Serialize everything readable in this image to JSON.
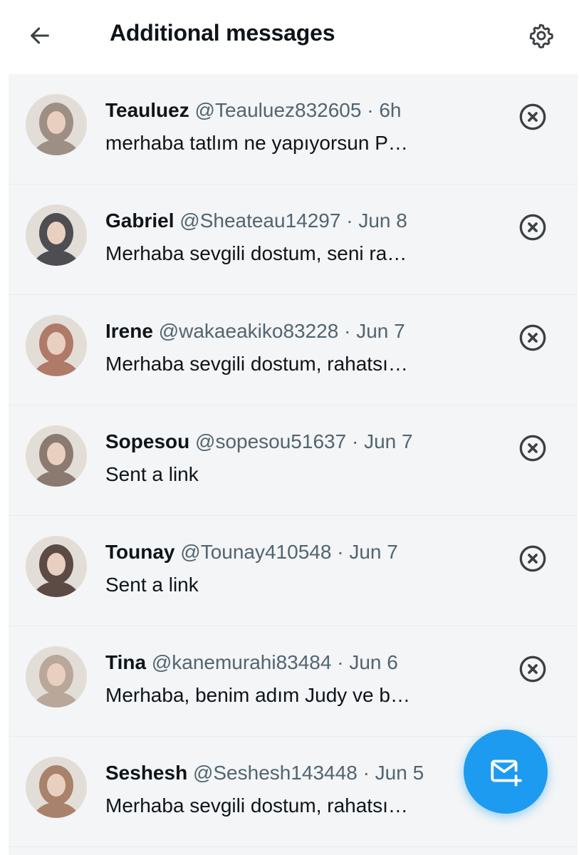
{
  "header": {
    "title": "Additional messages",
    "back_icon": "arrow-left-icon",
    "settings_icon": "gear-icon"
  },
  "conversations": [
    {
      "name": "Teauluez",
      "handle": "@Teauluez832605",
      "time": "6h",
      "preview": "merhaba tatlım ne yapıyorsun P…",
      "avatar_color": "#9e8f84"
    },
    {
      "name": "Gabriel",
      "handle": "@Sheateau14297",
      "time": "Jun 8",
      "preview": "Merhaba sevgili dostum, seni ra…",
      "avatar_color": "#4d4d52"
    },
    {
      "name": "Irene",
      "handle": "@wakaeakiko83228",
      "time": "Jun 7",
      "preview": "Merhaba sevgili dostum, rahatsı…",
      "avatar_color": "#b07a68"
    },
    {
      "name": "Sopesou",
      "handle": "@sopesou51637",
      "time": "Jun 7",
      "preview": "Sent a link",
      "avatar_color": "#8a7a70"
    },
    {
      "name": "Tounay",
      "handle": "@Tounay410548",
      "time": "Jun 7",
      "preview": "Sent a link",
      "avatar_color": "#5c4a44"
    },
    {
      "name": "Tina",
      "handle": "@kanemurahi83484",
      "time": "Jun 6",
      "preview": "Merhaba, benim adım Judy ve b…",
      "avatar_color": "#b9a79a"
    },
    {
      "name": "Seshesh",
      "handle": "@Seshesh143448",
      "time": "Jun 5",
      "preview": "Merhaba sevgili dostum, rahatsı…",
      "avatar_color": "#a8826a"
    }
  ],
  "dismiss_icon": "close-circle-icon",
  "fab": {
    "icon": "new-message-icon",
    "color": "#1d9bf0"
  },
  "colors": {
    "primary_text": "#0f1419",
    "secondary_text": "#536471",
    "list_background": "#f3f5f6",
    "accent": "#1d9bf0"
  }
}
